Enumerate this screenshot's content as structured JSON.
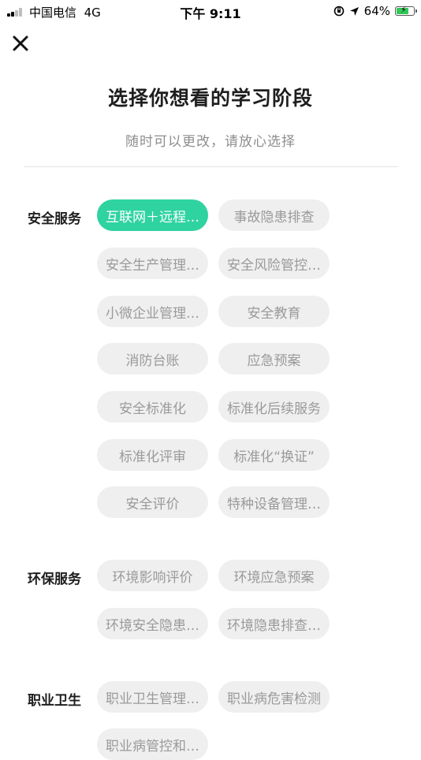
{
  "status": {
    "carrier": "中国电信",
    "network": "4G",
    "time": "下午 9:11",
    "battery": "64%",
    "battery_level": 0.64
  },
  "header": {
    "title": "选择你想看的学习阶段",
    "subtitle": "随时可以更改，请放心选择"
  },
  "colors": {
    "accent": "#2fd3a0",
    "chip_bg": "#efefef",
    "chip_text": "#9a9a9a"
  },
  "sections": [
    {
      "label": "安全服务",
      "options": [
        {
          "label": "互联网+远程监管",
          "display": "互联网＋远程…",
          "selected": true
        },
        {
          "label": "事故隐患排查",
          "display": "事故隐患排查",
          "selected": false
        },
        {
          "label": "安全生产管理",
          "display": "安全生产管理…",
          "selected": false
        },
        {
          "label": "安全风险管控",
          "display": "安全风险管控…",
          "selected": false
        },
        {
          "label": "小微企业管理",
          "display": "小微企业管理…",
          "selected": false
        },
        {
          "label": "安全教育",
          "display": "安全教育",
          "selected": false
        },
        {
          "label": "消防台账",
          "display": "消防台账",
          "selected": false
        },
        {
          "label": "应急预案",
          "display": "应急预案",
          "selected": false
        },
        {
          "label": "安全标准化",
          "display": "安全标准化",
          "selected": false
        },
        {
          "label": "标准化后续服务",
          "display": "标准化后续服务",
          "selected": false
        },
        {
          "label": "标准化评审",
          "display": "标准化评审",
          "selected": false
        },
        {
          "label": "标准化“换证”",
          "display": "标准化“换证”",
          "selected": false
        },
        {
          "label": "安全评价",
          "display": "安全评价",
          "selected": false
        },
        {
          "label": "特种设备管理",
          "display": "特种设备管理…",
          "selected": false
        }
      ]
    },
    {
      "label": "环保服务",
      "options": [
        {
          "label": "环境影响评价",
          "display": "环境影响评价",
          "selected": false
        },
        {
          "label": "环境应急预案",
          "display": "环境应急预案",
          "selected": false
        },
        {
          "label": "环境安全隐患",
          "display": "环境安全隐患…",
          "selected": false
        },
        {
          "label": "环境隐患排查",
          "display": "环境隐患排查…",
          "selected": false
        }
      ]
    },
    {
      "label": "职业卫生",
      "options": [
        {
          "label": "职业卫生管理",
          "display": "职业卫生管理…",
          "selected": false
        },
        {
          "label": "职业病危害检测",
          "display": "职业病危害检测",
          "selected": false
        },
        {
          "label": "职业病管控和",
          "display": "职业病管控和…",
          "selected": false
        }
      ]
    }
  ]
}
